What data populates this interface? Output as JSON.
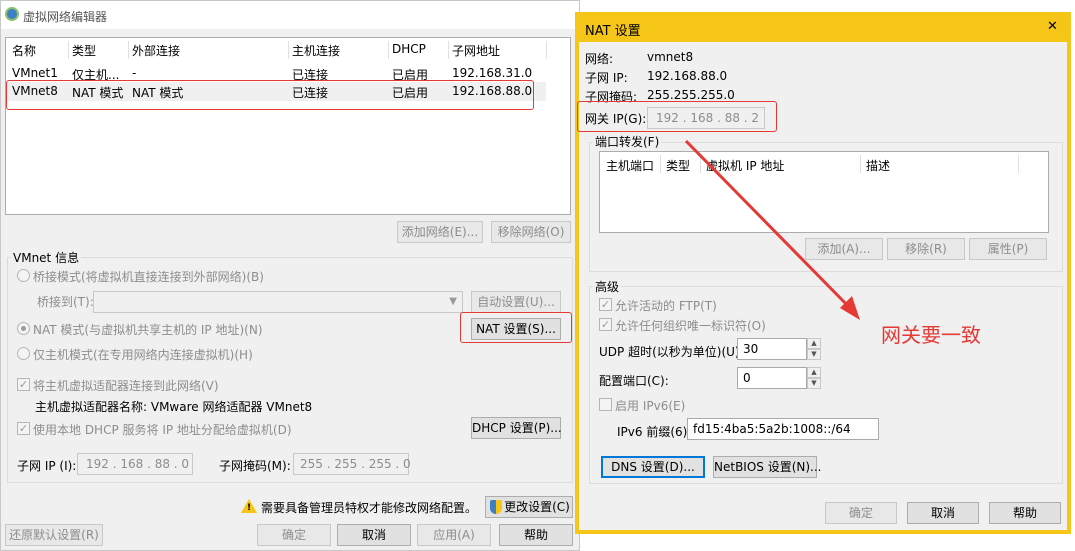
{
  "left": {
    "title": "虚拟网络编辑器",
    "table": {
      "headers": [
        "名称",
        "类型",
        "外部连接",
        "主机连接",
        "DHCP",
        "子网地址"
      ],
      "rows": [
        [
          "VMnet1",
          "仅主机...",
          "-",
          "已连接",
          "已启用",
          "192.168.31.0"
        ],
        [
          "VMnet8",
          "NAT 模式",
          "NAT 模式",
          "已连接",
          "已启用",
          "192.168.88.0"
        ]
      ]
    },
    "add_network": "添加网络(E)...",
    "remove_network": "移除网络(O)",
    "vmnet_info": "VMnet 信息",
    "bridge_mode": "桥接模式(将虚拟机直接连接到外部网络)(B)",
    "bridge_to": "桥接到(T):",
    "auto_settings": "自动设置(U)...",
    "nat_mode": "NAT 模式(与虚拟机共享主机的 IP 地址)(N)",
    "nat_settings": "NAT 设置(S)...",
    "host_only": "仅主机模式(在专用网络内连接虚拟机)(H)",
    "connect_adapter": "将主机虚拟适配器连接到此网络(V)",
    "adapter_name": "主机虚拟适配器名称: VMware 网络适配器 VMnet8",
    "use_dhcp": "使用本地 DHCP 服务将 IP 地址分配给虚拟机(D)",
    "dhcp_settings": "DHCP 设置(P)...",
    "subnet_ip_label": "子网 IP (I):",
    "subnet_ip": "192 . 168 . 88 . 0",
    "subnet_mask_label": "子网掩码(M):",
    "subnet_mask": "255 . 255 . 255 . 0",
    "admin_notice": "需要具备管理员特权才能修改网络配置。",
    "change_settings": "更改设置(C)",
    "restore_defaults": "还原默认设置(R)",
    "ok": "确定",
    "cancel": "取消",
    "apply": "应用(A)",
    "help": "帮助"
  },
  "right": {
    "title": "NAT 设置",
    "network_label": "网络:",
    "network": "vmnet8",
    "subnet_ip_label": "子网 IP:",
    "subnet_ip": "192.168.88.0",
    "subnet_mask_label": "子网掩码:",
    "subnet_mask": "255.255.255.0",
    "gateway_label": "网关 IP(G):",
    "gateway_ip": "192 . 168 . 88 . 2",
    "port_forwarding": "端口转发(F)",
    "pf_headers": [
      "主机端口",
      "类型",
      "虚拟机 IP 地址",
      "描述"
    ],
    "add": "添加(A)...",
    "remove": "移除(R)",
    "properties": "属性(P)",
    "advanced": "高级",
    "allow_ftp": "允许活动的 FTP(T)",
    "allow_oui": "允许任何组织唯一标识符(O)",
    "udp_timeout_label": "UDP 超时(以秒为单位)(U):",
    "udp_timeout": "30",
    "config_port_label": "配置端口(C):",
    "config_port": "0",
    "enable_ipv6": "启用 IPv6(E)",
    "ipv6_prefix_label": "IPv6 前缀(6):",
    "ipv6_prefix": "fd15:4ba5:5a2b:1008::/64",
    "dns_settings": "DNS 设置(D)...",
    "netbios_settings": "NetBIOS 设置(N)...",
    "ok": "确定",
    "cancel": "取消",
    "help": "帮助",
    "close_glyph": "✕"
  },
  "annotation": "网关要一致",
  "colors": {
    "accent": "#e53935",
    "nat_titlebar": "#f5c518"
  }
}
